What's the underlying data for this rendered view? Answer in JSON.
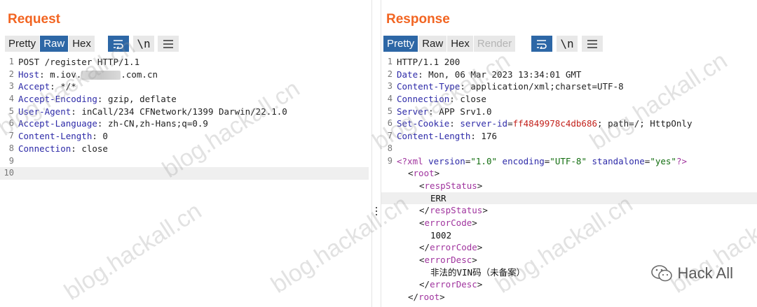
{
  "request": {
    "title": "Request",
    "tabs": [
      "Pretty",
      "Raw",
      "Hex"
    ],
    "active_tab": "Raw",
    "tools": [
      "wrap-icon",
      "newline-icon",
      "menu-icon"
    ],
    "newline_label": "\\n",
    "lines": [
      {
        "n": "1",
        "key": "",
        "text": "POST /register HTTP/1.1"
      },
      {
        "n": "2",
        "key": "Host",
        "value_pre": " m.iov.",
        "value_post": ".com.cn"
      },
      {
        "n": "3",
        "key": "Accept",
        "value": " */*"
      },
      {
        "n": "4",
        "key": "Accept-Encoding",
        "value": " gzip, deflate"
      },
      {
        "n": "5",
        "key": "User-Agent",
        "value": " inCall/234 CFNetwork/1399 Darwin/22.1.0"
      },
      {
        "n": "6",
        "key": "Accept-Language",
        "value": " zh-CN,zh-Hans;q=0.9"
      },
      {
        "n": "7",
        "key": "Content-Length",
        "value": " 0"
      },
      {
        "n": "8",
        "key": "Connection",
        "value": " close"
      },
      {
        "n": "9",
        "text": ""
      },
      {
        "n": "10",
        "text": ""
      }
    ]
  },
  "response": {
    "title": "Response",
    "tabs": [
      "Pretty",
      "Raw",
      "Hex",
      "Render"
    ],
    "active_tab": "Pretty",
    "newline_label": "\\n",
    "lines": {
      "l1": "HTTP/1.1 200",
      "l2k": "Date",
      "l2v": " Mon, 06 Mar 2023 13:34:01 GMT",
      "l3k": "Content-Type",
      "l3v": " application/xml;charset=UTF-8",
      "l4k": "Connection",
      "l4v": " close",
      "l5k": "Server",
      "l5v": " APP Srv1.0",
      "l6k": "Set-Cookie",
      "l6c": " server-id",
      "l6eq": "=",
      "l6cv": "ff4849978c4db686",
      "l6rest": "; path=/; HttpOnly",
      "l7k": "Content-Length",
      "l7v": " 176",
      "xml_decl_open": "<?xml ",
      "xml_a1": "version",
      "xml_v1": "\"1.0\"",
      "xml_a2": "encoding",
      "xml_v2": "\"UTF-8\"",
      "xml_a3": "standalone",
      "xml_v3": "\"yes\"",
      "xml_decl_close": "?>",
      "root_open": "root",
      "respStatus": "respStatus",
      "respStatus_value": "ERR",
      "errorCode": "errorCode",
      "errorCode_value": "1002",
      "errorDesc": "errorDesc",
      "errorDesc_value": "非法的VIN码（未备案）",
      "root_close": "root"
    }
  },
  "watermark": "blog.hackall.cn",
  "brand": "Hack All",
  "colors": {
    "accent": "#f26522",
    "active_tab": "#2d67a6"
  }
}
